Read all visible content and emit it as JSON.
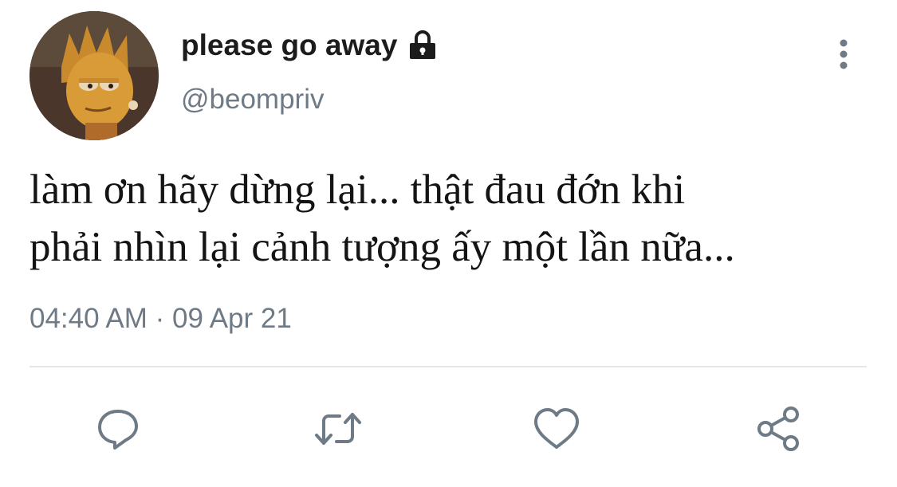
{
  "profile": {
    "display_name": "please go away",
    "handle": "@beompriv",
    "locked_icon": "lock-icon",
    "avatar_icon": "avatar"
  },
  "tweet": {
    "line1": "làm ơn hãy dừng lại... thật đau đớn khi",
    "line2": "phải nhìn lại cảnh tượng ấy một lần nữa...",
    "timestamp": "04:40 AM · 09 Apr 21"
  },
  "actions": [
    {
      "name": "reply",
      "icon": "reply-icon"
    },
    {
      "name": "retweet",
      "icon": "retweet-icon"
    },
    {
      "name": "like",
      "icon": "like-icon"
    },
    {
      "name": "share",
      "icon": "share-icon"
    }
  ],
  "colors": {
    "name_text": "#1c1c1c",
    "secondary_text": "#6e7a86",
    "icon_stroke": "#6e7a86",
    "divider": "#e4e7ea"
  }
}
